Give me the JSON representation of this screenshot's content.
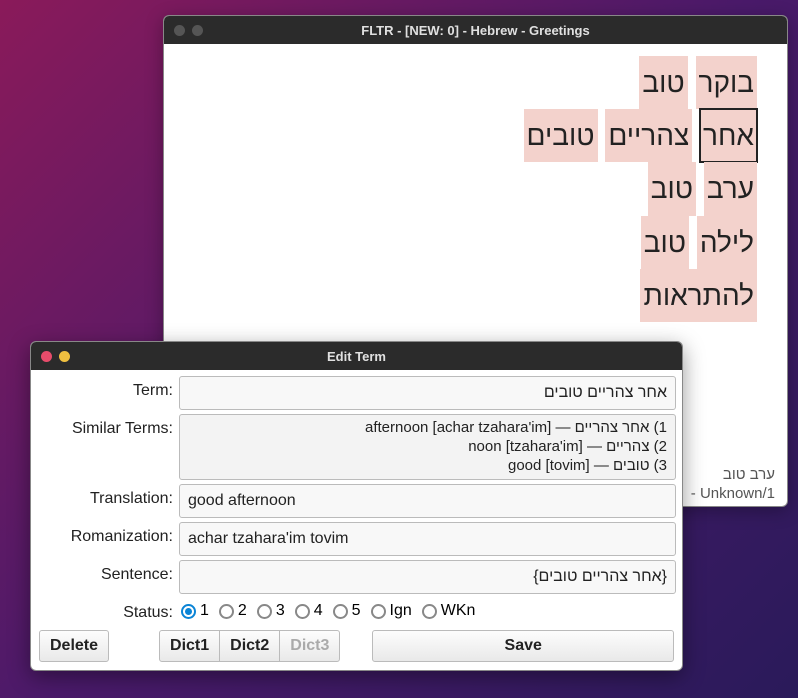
{
  "main": {
    "title": "FLTR - [NEW: 0] - Hebrew - Greetings",
    "lines": [
      [
        {
          "w": "בוקר",
          "cls": "hl-unknown"
        },
        {
          "w": "טוב",
          "cls": "hl-unknown"
        }
      ],
      [
        {
          "w": "אחר",
          "cls": "hl-selected"
        },
        {
          "w": "צהריים",
          "cls": "hl-unknown"
        },
        {
          "w": "טובים",
          "cls": "hl-unknown"
        }
      ],
      [
        {
          "w": "ערב",
          "cls": "hl-unknown"
        },
        {
          "w": "טוב",
          "cls": "hl-unknown"
        }
      ],
      [
        {
          "w": "לילה",
          "cls": "hl-unknown"
        },
        {
          "w": "טוב",
          "cls": "hl-unknown"
        }
      ],
      [
        {
          "w": "להתראות",
          "cls": "hl-unknown"
        }
      ]
    ],
    "status_line1": "ערב טוב",
    "status_line2": "- Unknown/1"
  },
  "edit": {
    "title": "Edit Term",
    "labels": {
      "term": "Term:",
      "similar": "Similar Terms:",
      "translation": "Translation:",
      "romanization": "Romanization:",
      "sentence": "Sentence:",
      "status": "Status:"
    },
    "term_value": "אחר צהריים טובים",
    "similar_lines": [
      "1) אחר צהריים — afternoon [achar tzahara'im]",
      "2) צהריים — noon [tzahara'im]",
      "3) טובים — good [tovim]"
    ],
    "translation_value": "good afternoon",
    "romanization_value": "achar tzahara'im tovim",
    "sentence_value": "{אחר צהריים טובים}",
    "status_options": [
      {
        "label": "1",
        "selected": true
      },
      {
        "label": "2",
        "selected": false
      },
      {
        "label": "3",
        "selected": false
      },
      {
        "label": "4",
        "selected": false
      },
      {
        "label": "5",
        "selected": false
      },
      {
        "label": "Ign",
        "selected": false
      },
      {
        "label": "WKn",
        "selected": false
      }
    ],
    "buttons": {
      "delete": "Delete",
      "dict1": "Dict1",
      "dict2": "Dict2",
      "dict3": "Dict3",
      "save": "Save"
    }
  }
}
